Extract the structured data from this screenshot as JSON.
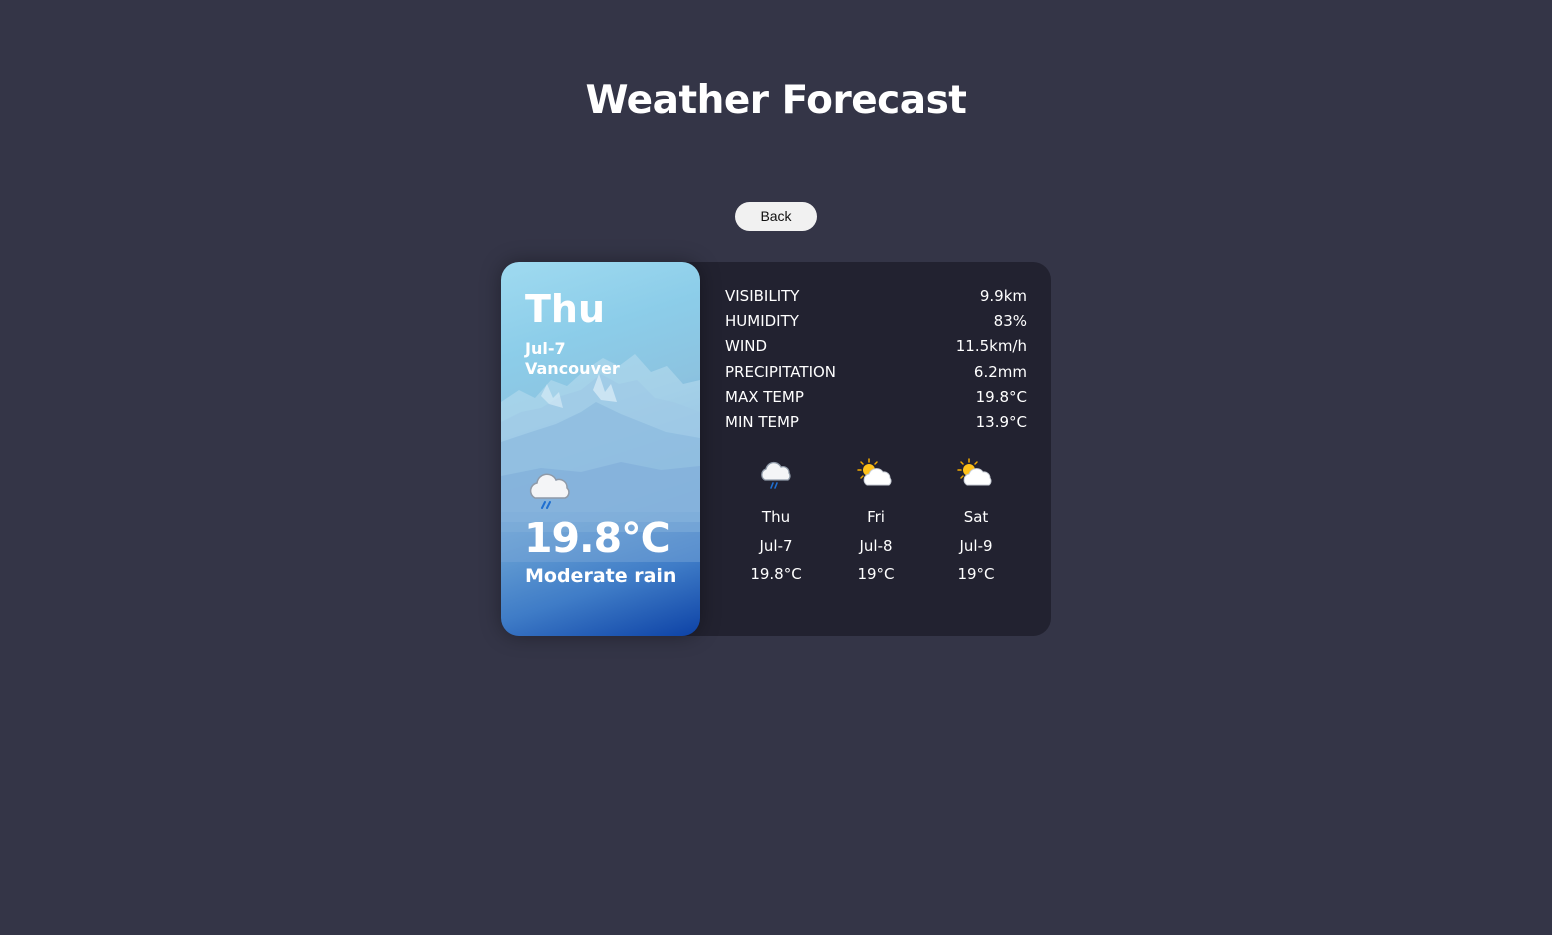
{
  "page": {
    "title": "Weather Forecast",
    "back_label": "Back"
  },
  "today": {
    "day": "Thu",
    "date": "Jul-7",
    "city": "Vancouver",
    "icon": "rain-cloud-icon",
    "temperature": "19.8°C",
    "condition": "Moderate rain"
  },
  "stats": [
    {
      "label": "VISIBILITY",
      "value": "9.9km"
    },
    {
      "label": "HUMIDITY",
      "value": "83%"
    },
    {
      "label": "WIND",
      "value": "11.5km/h"
    },
    {
      "label": "PRECIPITATION",
      "value": "6.2mm"
    },
    {
      "label": "MAX TEMP",
      "value": "19.8°C"
    },
    {
      "label": "MIN TEMP",
      "value": "13.9°C"
    }
  ],
  "forecast": [
    {
      "day": "Thu",
      "date": "Jul-7",
      "temp": "19.8°C",
      "icon": "rain-cloud-icon"
    },
    {
      "day": "Fri",
      "date": "Jul-8",
      "temp": "19°C",
      "icon": "partly-sunny-icon"
    },
    {
      "day": "Sat",
      "date": "Jul-9",
      "temp": "19°C",
      "icon": "partly-sunny-icon"
    }
  ],
  "colors": {
    "background": "#343547",
    "card": "#222230",
    "panel_gradient_top": "#9fdaf0",
    "panel_gradient_bottom": "#0d42a6",
    "button": "#f1f1f1"
  }
}
